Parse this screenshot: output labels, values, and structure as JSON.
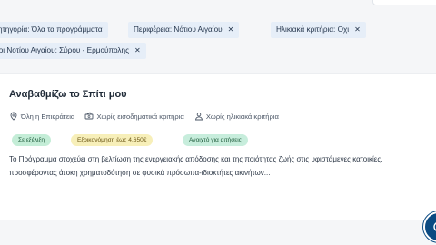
{
  "filters": [
    {
      "label": "ητηγορία: Όλα τα προγράμματα"
    },
    {
      "label": "Περιφέρεια: Νότιου Αιγαίου",
      "remove": "✕"
    },
    {
      "label": "Ηλικιακά κριτήρια: Οχι",
      "remove": "✕"
    },
    {
      "label": "μοι Νοτίου Αιγαίου: Σύρου - Ερμούπολης",
      "remove": "✕"
    }
  ],
  "program": {
    "title": "Αναβαθμίζω το Σπίτι μου",
    "meta": [
      {
        "icon": "location-pin-icon",
        "text": "Όλη η Επικράτεια"
      },
      {
        "icon": "money-icon",
        "text": "Χωρίς εισοδηματικά κριτήρια"
      },
      {
        "icon": "person-icon",
        "text": "Χωρίς ηλικιακά κριτήρια"
      }
    ],
    "badges": [
      {
        "text": "Σε εξέλιξη",
        "color": "#c4edd7"
      },
      {
        "text": "Εξοικονόμηση έως 4.650€",
        "color": "#f7efb9"
      },
      {
        "text": "Ανοιχτό για αιτήσεις",
        "color": "#c7eddc"
      }
    ],
    "description": "Το Πρόγραμμα στοχεύει στη βελτίωση της ενεργειακής απόδοσης και της ποιότητας ζωής στις υφιστάμενες κατοικίες, προσφέροντας άτοκη χρηματοδότηση σε φυσικά πρόσωπα-ιδιοκτήτες ακινήτων..."
  },
  "colors": {
    "accent": "#0b4a82",
    "chip_bg": "#e6eef8"
  }
}
